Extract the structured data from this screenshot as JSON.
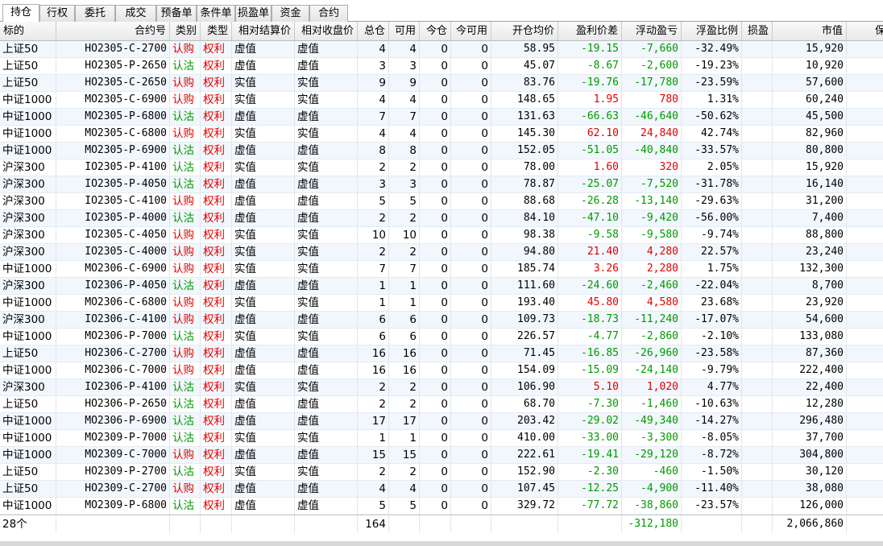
{
  "tabs": [
    "持仓",
    "行权",
    "委托",
    "成交",
    "预备单",
    "条件单",
    "损盈单",
    "资金",
    "合约"
  ],
  "columns": [
    "标的",
    "合约号",
    "类别",
    "类型",
    "相对结算价",
    "相对收盘价",
    "总仓",
    "可用",
    "今仓",
    "今可用",
    "开仓均价",
    "盈利价差",
    "浮动盈亏",
    "浮盈比例",
    "损盈",
    "市值",
    "保证金"
  ],
  "rows": [
    {
      "underlying": "上证50",
      "code": "HO2305-C-2700",
      "cls": "认购",
      "type": "权利",
      "rel_settle": "虚值",
      "rel_close": "虚值",
      "total": "4",
      "avail": "4",
      "today": "0",
      "today_avail": "0",
      "avg": "58.95",
      "diff": "-19.15",
      "pnl": "-7,660",
      "ratio": "-32.49%",
      "sl": "",
      "mv": "15,920"
    },
    {
      "underlying": "上证50",
      "code": "HO2305-P-2650",
      "cls": "认沽",
      "type": "权利",
      "rel_settle": "虚值",
      "rel_close": "虚值",
      "total": "3",
      "avail": "3",
      "today": "0",
      "today_avail": "0",
      "avg": "45.07",
      "diff": "-8.67",
      "pnl": "-2,600",
      "ratio": "-19.23%",
      "sl": "",
      "mv": "10,920"
    },
    {
      "underlying": "上证50",
      "code": "HO2305-C-2650",
      "cls": "认购",
      "type": "权利",
      "rel_settle": "实值",
      "rel_close": "实值",
      "total": "9",
      "avail": "9",
      "today": "0",
      "today_avail": "0",
      "avg": "83.76",
      "diff": "-19.76",
      "pnl": "-17,780",
      "ratio": "-23.59%",
      "sl": "",
      "mv": "57,600"
    },
    {
      "underlying": "中证1000",
      "code": "MO2305-C-6900",
      "cls": "认购",
      "type": "权利",
      "rel_settle": "实值",
      "rel_close": "实值",
      "total": "4",
      "avail": "4",
      "today": "0",
      "today_avail": "0",
      "avg": "148.65",
      "diff": "1.95",
      "pnl": "780",
      "ratio": "1.31%",
      "sl": "",
      "mv": "60,240"
    },
    {
      "underlying": "中证1000",
      "code": "MO2305-P-6800",
      "cls": "认沽",
      "type": "权利",
      "rel_settle": "虚值",
      "rel_close": "虚值",
      "total": "7",
      "avail": "7",
      "today": "0",
      "today_avail": "0",
      "avg": "131.63",
      "diff": "-66.63",
      "pnl": "-46,640",
      "ratio": "-50.62%",
      "sl": "",
      "mv": "45,500"
    },
    {
      "underlying": "中证1000",
      "code": "MO2305-C-6800",
      "cls": "认购",
      "type": "权利",
      "rel_settle": "实值",
      "rel_close": "实值",
      "total": "4",
      "avail": "4",
      "today": "0",
      "today_avail": "0",
      "avg": "145.30",
      "diff": "62.10",
      "pnl": "24,840",
      "ratio": "42.74%",
      "sl": "",
      "mv": "82,960"
    },
    {
      "underlying": "中证1000",
      "code": "MO2305-P-6900",
      "cls": "认沽",
      "type": "权利",
      "rel_settle": "虚值",
      "rel_close": "虚值",
      "total": "8",
      "avail": "8",
      "today": "0",
      "today_avail": "0",
      "avg": "152.05",
      "diff": "-51.05",
      "pnl": "-40,840",
      "ratio": "-33.57%",
      "sl": "",
      "mv": "80,800"
    },
    {
      "underlying": "沪深300",
      "code": "IO2305-P-4100",
      "cls": "认沽",
      "type": "权利",
      "rel_settle": "实值",
      "rel_close": "实值",
      "total": "2",
      "avail": "2",
      "today": "0",
      "today_avail": "0",
      "avg": "78.00",
      "diff": "1.60",
      "pnl": "320",
      "ratio": "2.05%",
      "sl": "",
      "mv": "15,920"
    },
    {
      "underlying": "沪深300",
      "code": "IO2305-P-4050",
      "cls": "认沽",
      "type": "权利",
      "rel_settle": "虚值",
      "rel_close": "虚值",
      "total": "3",
      "avail": "3",
      "today": "0",
      "today_avail": "0",
      "avg": "78.87",
      "diff": "-25.07",
      "pnl": "-7,520",
      "ratio": "-31.78%",
      "sl": "",
      "mv": "16,140"
    },
    {
      "underlying": "沪深300",
      "code": "IO2305-C-4100",
      "cls": "认购",
      "type": "权利",
      "rel_settle": "虚值",
      "rel_close": "虚值",
      "total": "5",
      "avail": "5",
      "today": "0",
      "today_avail": "0",
      "avg": "88.68",
      "diff": "-26.28",
      "pnl": "-13,140",
      "ratio": "-29.63%",
      "sl": "",
      "mv": "31,200"
    },
    {
      "underlying": "沪深300",
      "code": "IO2305-P-4000",
      "cls": "认沽",
      "type": "权利",
      "rel_settle": "虚值",
      "rel_close": "虚值",
      "total": "2",
      "avail": "2",
      "today": "0",
      "today_avail": "0",
      "avg": "84.10",
      "diff": "-47.10",
      "pnl": "-9,420",
      "ratio": "-56.00%",
      "sl": "",
      "mv": "7,400"
    },
    {
      "underlying": "沪深300",
      "code": "IO2305-C-4050",
      "cls": "认购",
      "type": "权利",
      "rel_settle": "实值",
      "rel_close": "实值",
      "total": "10",
      "avail": "10",
      "today": "0",
      "today_avail": "0",
      "avg": "98.38",
      "diff": "-9.58",
      "pnl": "-9,580",
      "ratio": "-9.74%",
      "sl": "",
      "mv": "88,800"
    },
    {
      "underlying": "沪深300",
      "code": "IO2305-C-4000",
      "cls": "认购",
      "type": "权利",
      "rel_settle": "实值",
      "rel_close": "实值",
      "total": "2",
      "avail": "2",
      "today": "0",
      "today_avail": "0",
      "avg": "94.80",
      "diff": "21.40",
      "pnl": "4,280",
      "ratio": "22.57%",
      "sl": "",
      "mv": "23,240"
    },
    {
      "underlying": "中证1000",
      "code": "MO2306-C-6900",
      "cls": "认购",
      "type": "权利",
      "rel_settle": "实值",
      "rel_close": "实值",
      "total": "7",
      "avail": "7",
      "today": "0",
      "today_avail": "0",
      "avg": "185.74",
      "diff": "3.26",
      "pnl": "2,280",
      "ratio": "1.75%",
      "sl": "",
      "mv": "132,300"
    },
    {
      "underlying": "沪深300",
      "code": "IO2306-P-4050",
      "cls": "认沽",
      "type": "权利",
      "rel_settle": "虚值",
      "rel_close": "虚值",
      "total": "1",
      "avail": "1",
      "today": "0",
      "today_avail": "0",
      "avg": "111.60",
      "diff": "-24.60",
      "pnl": "-2,460",
      "ratio": "-22.04%",
      "sl": "",
      "mv": "8,700"
    },
    {
      "underlying": "中证1000",
      "code": "MO2306-C-6800",
      "cls": "认购",
      "type": "权利",
      "rel_settle": "实值",
      "rel_close": "实值",
      "total": "1",
      "avail": "1",
      "today": "0",
      "today_avail": "0",
      "avg": "193.40",
      "diff": "45.80",
      "pnl": "4,580",
      "ratio": "23.68%",
      "sl": "",
      "mv": "23,920"
    },
    {
      "underlying": "沪深300",
      "code": "IO2306-C-4100",
      "cls": "认购",
      "type": "权利",
      "rel_settle": "虚值",
      "rel_close": "虚值",
      "total": "6",
      "avail": "6",
      "today": "0",
      "today_avail": "0",
      "avg": "109.73",
      "diff": "-18.73",
      "pnl": "-11,240",
      "ratio": "-17.07%",
      "sl": "",
      "mv": "54,600"
    },
    {
      "underlying": "中证1000",
      "code": "MO2306-P-7000",
      "cls": "认沽",
      "type": "权利",
      "rel_settle": "实值",
      "rel_close": "实值",
      "total": "6",
      "avail": "6",
      "today": "0",
      "today_avail": "0",
      "avg": "226.57",
      "diff": "-4.77",
      "pnl": "-2,860",
      "ratio": "-2.10%",
      "sl": "",
      "mv": "133,080"
    },
    {
      "underlying": "上证50",
      "code": "HO2306-C-2700",
      "cls": "认购",
      "type": "权利",
      "rel_settle": "虚值",
      "rel_close": "虚值",
      "total": "16",
      "avail": "16",
      "today": "0",
      "today_avail": "0",
      "avg": "71.45",
      "diff": "-16.85",
      "pnl": "-26,960",
      "ratio": "-23.58%",
      "sl": "",
      "mv": "87,360"
    },
    {
      "underlying": "中证1000",
      "code": "MO2306-C-7000",
      "cls": "认购",
      "type": "权利",
      "rel_settle": "虚值",
      "rel_close": "虚值",
      "total": "16",
      "avail": "16",
      "today": "0",
      "today_avail": "0",
      "avg": "154.09",
      "diff": "-15.09",
      "pnl": "-24,140",
      "ratio": "-9.79%",
      "sl": "",
      "mv": "222,400"
    },
    {
      "underlying": "沪深300",
      "code": "IO2306-P-4100",
      "cls": "认沽",
      "type": "权利",
      "rel_settle": "实值",
      "rel_close": "实值",
      "total": "2",
      "avail": "2",
      "today": "0",
      "today_avail": "0",
      "avg": "106.90",
      "diff": "5.10",
      "pnl": "1,020",
      "ratio": "4.77%",
      "sl": "",
      "mv": "22,400"
    },
    {
      "underlying": "上证50",
      "code": "HO2306-P-2650",
      "cls": "认沽",
      "type": "权利",
      "rel_settle": "虚值",
      "rel_close": "虚值",
      "total": "2",
      "avail": "2",
      "today": "0",
      "today_avail": "0",
      "avg": "68.70",
      "diff": "-7.30",
      "pnl": "-1,460",
      "ratio": "-10.63%",
      "sl": "",
      "mv": "12,280"
    },
    {
      "underlying": "中证1000",
      "code": "MO2306-P-6900",
      "cls": "认沽",
      "type": "权利",
      "rel_settle": "虚值",
      "rel_close": "虚值",
      "total": "17",
      "avail": "17",
      "today": "0",
      "today_avail": "0",
      "avg": "203.42",
      "diff": "-29.02",
      "pnl": "-49,340",
      "ratio": "-14.27%",
      "sl": "",
      "mv": "296,480"
    },
    {
      "underlying": "中证1000",
      "code": "MO2309-P-7000",
      "cls": "认沽",
      "type": "权利",
      "rel_settle": "实值",
      "rel_close": "实值",
      "total": "1",
      "avail": "1",
      "today": "0",
      "today_avail": "0",
      "avg": "410.00",
      "diff": "-33.00",
      "pnl": "-3,300",
      "ratio": "-8.05%",
      "sl": "",
      "mv": "37,700"
    },
    {
      "underlying": "中证1000",
      "code": "MO2309-C-7000",
      "cls": "认购",
      "type": "权利",
      "rel_settle": "虚值",
      "rel_close": "虚值",
      "total": "15",
      "avail": "15",
      "today": "0",
      "today_avail": "0",
      "avg": "222.61",
      "diff": "-19.41",
      "pnl": "-29,120",
      "ratio": "-8.72%",
      "sl": "",
      "mv": "304,800"
    },
    {
      "underlying": "上证50",
      "code": "HO2309-P-2700",
      "cls": "认沽",
      "type": "权利",
      "rel_settle": "实值",
      "rel_close": "实值",
      "total": "2",
      "avail": "2",
      "today": "0",
      "today_avail": "0",
      "avg": "152.90",
      "diff": "-2.30",
      "pnl": "-460",
      "ratio": "-1.50%",
      "sl": "",
      "mv": "30,120"
    },
    {
      "underlying": "上证50",
      "code": "HO2309-C-2700",
      "cls": "认购",
      "type": "权利",
      "rel_settle": "虚值",
      "rel_close": "虚值",
      "total": "4",
      "avail": "4",
      "today": "0",
      "today_avail": "0",
      "avg": "107.45",
      "diff": "-12.25",
      "pnl": "-4,900",
      "ratio": "-11.40%",
      "sl": "",
      "mv": "38,080"
    },
    {
      "underlying": "中证1000",
      "code": "MO2309-P-6800",
      "cls": "认沽",
      "type": "权利",
      "rel_settle": "虚值",
      "rel_close": "虚值",
      "total": "5",
      "avail": "5",
      "today": "0",
      "today_avail": "0",
      "avg": "329.72",
      "diff": "-77.72",
      "pnl": "-38,860",
      "ratio": "-23.57%",
      "sl": "",
      "mv": "126,000"
    }
  ],
  "footer": {
    "count": "28个",
    "total": "164",
    "pnl": "-312,180",
    "mv": "2,066,860"
  },
  "colors": {
    "call": "#e00000",
    "put": "#009900",
    "type": "#e00000",
    "gain": "#e00000",
    "loss": "#009900",
    "row_alt": "#f1f7fd"
  }
}
